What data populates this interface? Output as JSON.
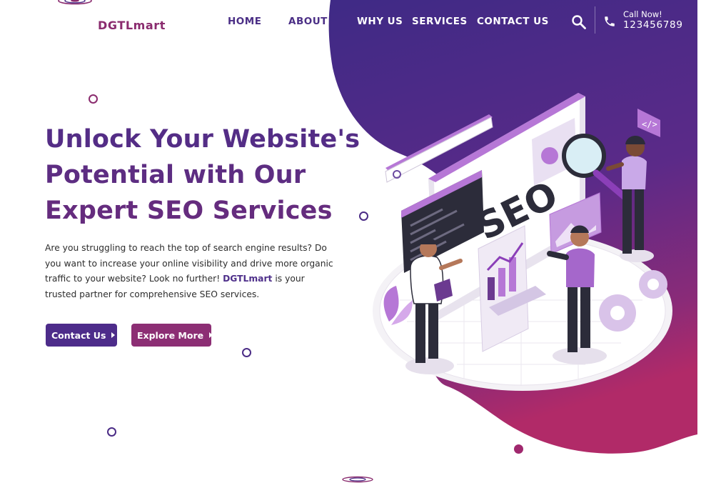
{
  "brand": {
    "name": "DGTLmart"
  },
  "nav": {
    "items": [
      {
        "label": "HOME"
      },
      {
        "label": "ABOUT"
      },
      {
        "label": "WHY US"
      },
      {
        "label": "SERVICES"
      },
      {
        "label": "CONTACT US"
      }
    ]
  },
  "header": {
    "call_label": "Call Now!",
    "call_number": "123456789",
    "search_icon": "search-icon",
    "phone_icon": "phone-icon"
  },
  "hero": {
    "title_lines": [
      "Unlock Your Website's",
      "Potential with Our",
      "Expert SEO Services"
    ],
    "description_part1": "Are you struggling to reach the top of search engine results? Do you want to increase your online visibility and drive more organic traffic to your website? Look no further! ",
    "description_brand": "DGTLmart",
    "description_part2": " is your trusted partner for comprehensive SEO services.",
    "buttons": {
      "contact_label": "Contact Us",
      "explore_label": "Explore More"
    },
    "illustration_text": "SEO"
  },
  "colors": {
    "purple_dark": "#4b2c86",
    "magenta": "#a0286e",
    "title_gradient_start": "#4a2d85",
    "title_gradient_end": "#8c2b70",
    "button_contact": "#4d2c8a",
    "button_explore": "#8c2e74"
  }
}
